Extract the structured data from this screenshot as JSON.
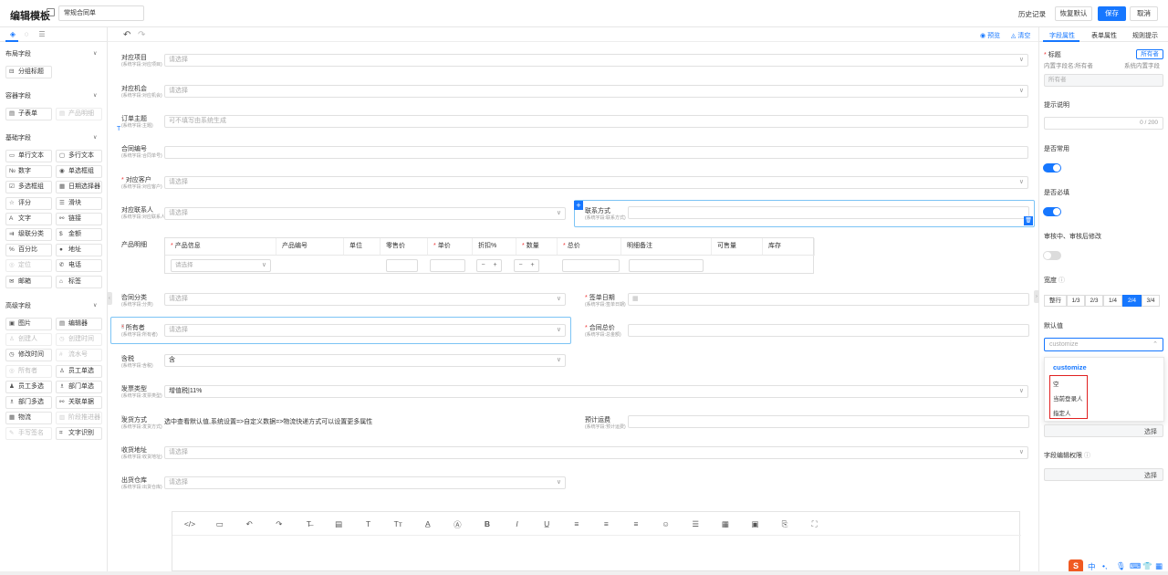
{
  "header": {
    "title": "编辑模板",
    "template_name": "常规合同单",
    "history": "历史记录",
    "restore": "恢复默认",
    "save": "保存",
    "cancel": "取消"
  },
  "colors": {
    "accent": "#1677ff",
    "required": "#e33333",
    "highlight_box": "#e02020"
  },
  "left_panel": {
    "groups": [
      {
        "title": "布局字段",
        "items": [
          {
            "label": "分组标题",
            "icon": "group-icon",
            "enabled": true
          }
        ]
      },
      {
        "title": "容器字段",
        "items": [
          {
            "label": "子表单",
            "icon": "table-icon",
            "enabled": true
          },
          {
            "label": "产品明细",
            "icon": "table-icon",
            "enabled": false
          }
        ]
      },
      {
        "title": "基础字段",
        "items": [
          {
            "label": "单行文本",
            "icon": "input-icon",
            "enabled": true
          },
          {
            "label": "多行文本",
            "icon": "textarea-icon",
            "enabled": true
          },
          {
            "label": "数字",
            "icon": "number-icon",
            "enabled": true
          },
          {
            "label": "单选框组",
            "icon": "radio-icon",
            "enabled": true
          },
          {
            "label": "多选框组",
            "icon": "checkbox-icon",
            "enabled": true
          },
          {
            "label": "日期选择器",
            "icon": "calendar-icon",
            "enabled": true
          },
          {
            "label": "评分",
            "icon": "star-icon",
            "enabled": true
          },
          {
            "label": "滑块",
            "icon": "slider-icon",
            "enabled": true
          },
          {
            "label": "文字",
            "icon": "text-icon",
            "enabled": true
          },
          {
            "label": "链接",
            "icon": "link-icon",
            "enabled": true
          },
          {
            "label": "级联分类",
            "icon": "cascade-icon",
            "enabled": true
          },
          {
            "label": "金额",
            "icon": "money-icon",
            "enabled": true
          },
          {
            "label": "百分比",
            "icon": "percent-icon",
            "enabled": true
          },
          {
            "label": "地址",
            "icon": "location-icon",
            "enabled": true
          },
          {
            "label": "定位",
            "icon": "locate-icon",
            "enabled": false
          },
          {
            "label": "电话",
            "icon": "phone-icon",
            "enabled": true
          },
          {
            "label": "邮箱",
            "icon": "mail-icon",
            "enabled": true
          },
          {
            "label": "标签",
            "icon": "tag-icon",
            "enabled": true
          }
        ]
      },
      {
        "title": "高级字段",
        "items": [
          {
            "label": "图片",
            "icon": "image-icon",
            "enabled": true
          },
          {
            "label": "编辑器",
            "icon": "editor-icon",
            "enabled": true
          },
          {
            "label": "创建人",
            "icon": "user-icon",
            "enabled": false
          },
          {
            "label": "创建时间",
            "icon": "clock-icon",
            "enabled": false
          },
          {
            "label": "修改时间",
            "icon": "clock-icon",
            "enabled": true
          },
          {
            "label": "流水号",
            "icon": "serial-icon",
            "enabled": false
          },
          {
            "label": "所有者",
            "icon": "owner-icon",
            "enabled": false
          },
          {
            "label": "员工单选",
            "icon": "user-icon",
            "enabled": true
          },
          {
            "label": "员工多选",
            "icon": "users-icon",
            "enabled": true
          },
          {
            "label": "部门单选",
            "icon": "dept-icon",
            "enabled": true
          },
          {
            "label": "部门多选",
            "icon": "dept-icon",
            "enabled": true
          },
          {
            "label": "关联单据",
            "icon": "link-icon",
            "enabled": true
          },
          {
            "label": "物流",
            "icon": "truck-icon",
            "enabled": true
          },
          {
            "label": "阶段推进器",
            "icon": "stage-icon",
            "enabled": false
          },
          {
            "label": "手写签名",
            "icon": "sign-icon",
            "enabled": false
          },
          {
            "label": "文字识别",
            "icon": "ocr-icon",
            "enabled": true
          }
        ]
      }
    ]
  },
  "canvas": {
    "preview": "预览",
    "clear": "清空",
    "fields": [
      {
        "label": "对应项目",
        "sub": "(系统字段:对应项目)",
        "placeholder": "请选择",
        "required": false
      },
      {
        "label": "对应机会",
        "sub": "(系统字段:对应机会)",
        "placeholder": "请选择",
        "required": false
      },
      {
        "label": "订单主题",
        "sub": "(系统字段:主题)",
        "placeholder": "可不填写由系统生成",
        "required": false
      },
      {
        "label": "合同编号",
        "sub": "(系统字段:合同单号)",
        "placeholder": "",
        "required": false
      },
      {
        "label": "对应客户",
        "sub": "(系统字段:对应客户)",
        "placeholder": "请选择",
        "required": true
      },
      {
        "label": "对应联系人",
        "sub": "(系统字段:对应联系人)",
        "placeholder": "请选择",
        "required": false
      },
      {
        "label": "联系方式",
        "sub": "(系统字段:联系方式)",
        "placeholder": "",
        "required": false
      },
      {
        "label": "产品明细",
        "sub": "",
        "placeholder": "",
        "required": false
      },
      {
        "label": "合同分类",
        "sub": "(系统字段:分类)",
        "placeholder": "请选择",
        "required": false
      },
      {
        "label": "签单日期",
        "sub": "(系统字段:签单日期)",
        "placeholder": "",
        "required": true
      },
      {
        "label": "所有者",
        "sub": "(系统字段:所有者)",
        "placeholder": "请选择",
        "required": true
      },
      {
        "label": "合同总价",
        "sub": "(系统字段:总金额)",
        "placeholder": "",
        "required": true
      },
      {
        "label": "含税",
        "sub": "(系统字段:含税)",
        "value": "含",
        "required": false
      },
      {
        "label": "发票类型",
        "sub": "(系统字段:发票类型)",
        "value": "增值税|11%",
        "required": false
      },
      {
        "label": "发货方式",
        "sub": "(系统字段:发货方式)",
        "value": "选中查看默认值,系统设置=>自定义数据=>物流快递方式可以设置更多属性",
        "required": false
      },
      {
        "label": "预计运费",
        "sub": "(系统字段:预计运费)",
        "placeholder": "",
        "required": false
      },
      {
        "label": "收货地址",
        "sub": "(系统字段:收货地址)",
        "placeholder": "请选择",
        "required": false
      },
      {
        "label": "出货仓库",
        "sub": "(系统字段:出货仓库)",
        "placeholder": "请选择",
        "required": false
      }
    ],
    "product_table": {
      "headers": [
        {
          "label": "产品信息",
          "required": true
        },
        {
          "label": "产品编号",
          "required": false
        },
        {
          "label": "单位",
          "required": false
        },
        {
          "label": "零售价",
          "required": false
        },
        {
          "label": "单价",
          "required": true
        },
        {
          "label": "折扣%",
          "required": false
        },
        {
          "label": "数量",
          "required": true
        },
        {
          "label": "总价",
          "required": true
        },
        {
          "label": "明细备注",
          "required": false
        },
        {
          "label": "可售量",
          "required": false
        },
        {
          "label": "库存",
          "required": false
        }
      ],
      "select_placeholder": "请选择",
      "minus": "−",
      "plus": "+"
    },
    "editor_tools": [
      "code-icon",
      "layout-icon",
      "undo-icon",
      "redo-icon",
      "strikethrough-icon",
      "document-icon",
      "text-icon",
      "font-size-icon",
      "font-color-icon",
      "background-color-icon",
      "bold-icon",
      "italic-icon",
      "underline-icon",
      "align-left-icon",
      "align-center-icon",
      "align-right-icon",
      "emoji-icon",
      "list-icon",
      "table-icon",
      "image-icon",
      "attachment-icon",
      "fullscreen-icon"
    ]
  },
  "right_panel": {
    "tabs": [
      "字段属性",
      "表单属性",
      "规则提示"
    ],
    "title_label": "标题",
    "owner_tag": "所有者",
    "internal_field": "内置字段名:所有者",
    "system_field": "系统内置字段",
    "title_value": "所有者",
    "hint_label": "提示说明",
    "hint_count": "0 / 200",
    "common_label": "是否常用",
    "required_label": "是否必填",
    "review_label": "审核中、审核后修改",
    "width_label": "宽度",
    "widths": [
      "整行",
      "1/3",
      "2/3",
      "1/4",
      "2/4",
      "3/4"
    ],
    "width_selected": "2/4",
    "default_label": "默认值",
    "default_placeholder": "customize",
    "dropdown_head": "customize",
    "dropdown_items": [
      "空",
      "当前登录人",
      "指定人"
    ],
    "choose": "选择",
    "perm_label": "字段编辑权限",
    "toggles": {
      "common": true,
      "required": true,
      "review": false
    }
  },
  "tray": {
    "badge": "S",
    "ime": "中",
    "icons": [
      "punctuation-icon",
      "mic-icon",
      "keyboard-icon",
      "shirt-icon",
      "grid-icon"
    ]
  }
}
